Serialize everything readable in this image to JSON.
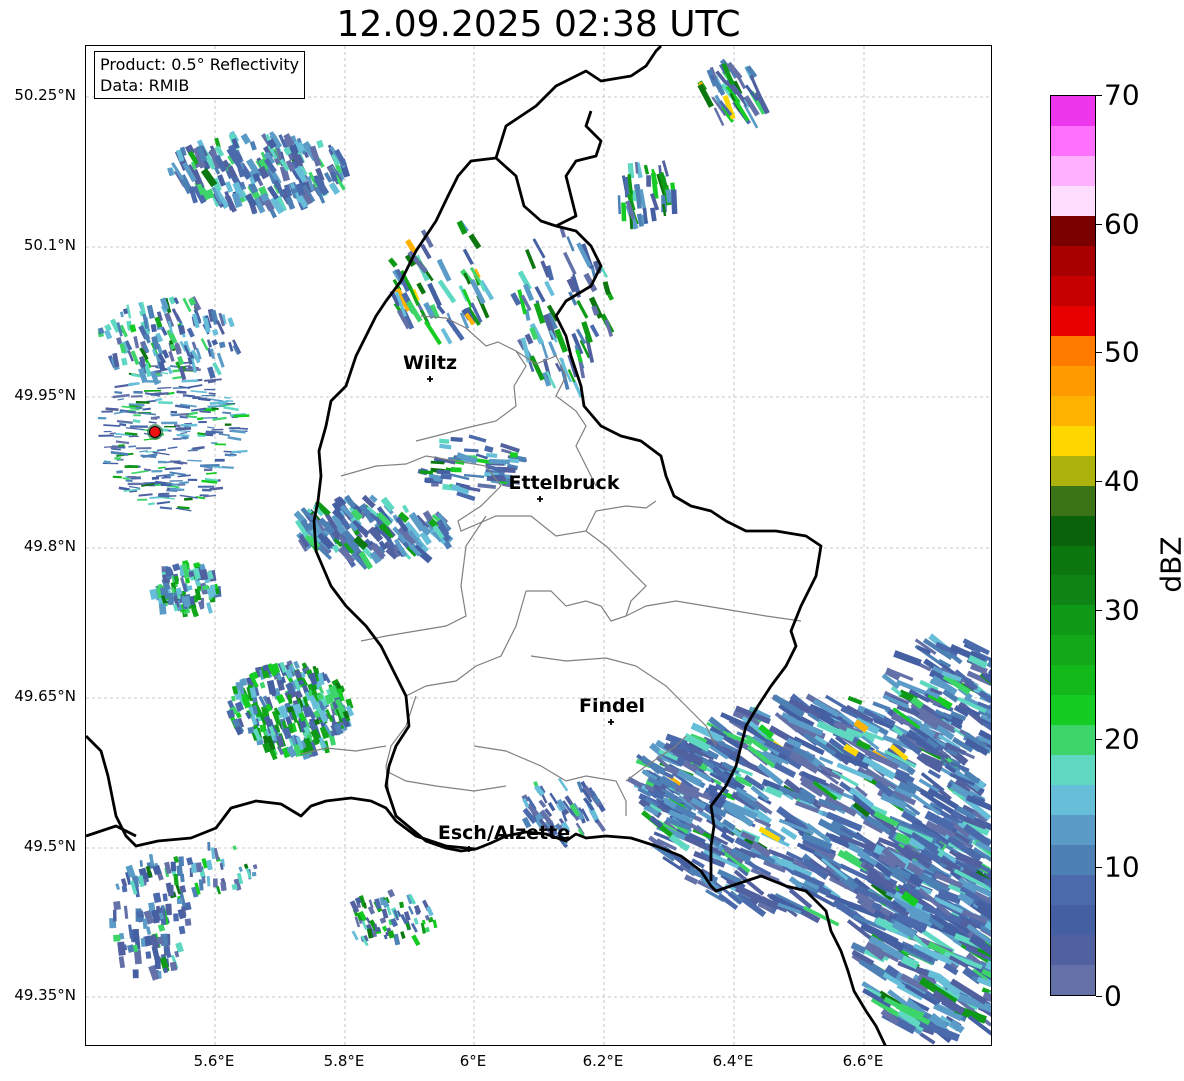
{
  "title": "12.09.2025 02:38 UTC",
  "info": {
    "product": "Product: 0.5° Reflectivity",
    "data": "Data: RMIB"
  },
  "lat_labels": [
    "50.25°N",
    "50.1°N",
    "49.95°N",
    "49.8°N",
    "49.65°N",
    "49.5°N",
    "49.35°N"
  ],
  "lon_labels": [
    "5.6°E",
    "5.8°E",
    "6°E",
    "6.2°E",
    "6.4°E",
    "6.6°E"
  ],
  "cities": [
    {
      "name": "Wiltz"
    },
    {
      "name": "Ettelbruck"
    },
    {
      "name": "Findel"
    },
    {
      "name": "Esch/Alzette"
    }
  ],
  "colorbar": {
    "label": "dBZ",
    "ticks": [
      "0",
      "10",
      "20",
      "30",
      "40",
      "50",
      "60",
      "70"
    ],
    "min": 0,
    "max": 70,
    "step": 2.5,
    "colors": [
      "#6470a8",
      "#51609e",
      "#4460a3",
      "#4a6aac",
      "#4d80b4",
      "#5a9cc7",
      "#66bed9",
      "#5fd8c2",
      "#3dd46a",
      "#14cc22",
      "#13b81a",
      "#12a81a",
      "#0e9a16",
      "#0e8414",
      "#0c760f",
      "#0a620a",
      "#3b7417",
      "#adb20c",
      "#ffd700",
      "#ffb300",
      "#ff9a00",
      "#ff7b00",
      "#e80000",
      "#c60000",
      "#a80000",
      "#7a0000",
      "#ffddff",
      "#ffb0ff",
      "#ff70ff",
      "#ec37ec"
    ]
  },
  "radar_site_color": "#ee1111",
  "border_color": "#000000",
  "canton_color": "#808080"
}
